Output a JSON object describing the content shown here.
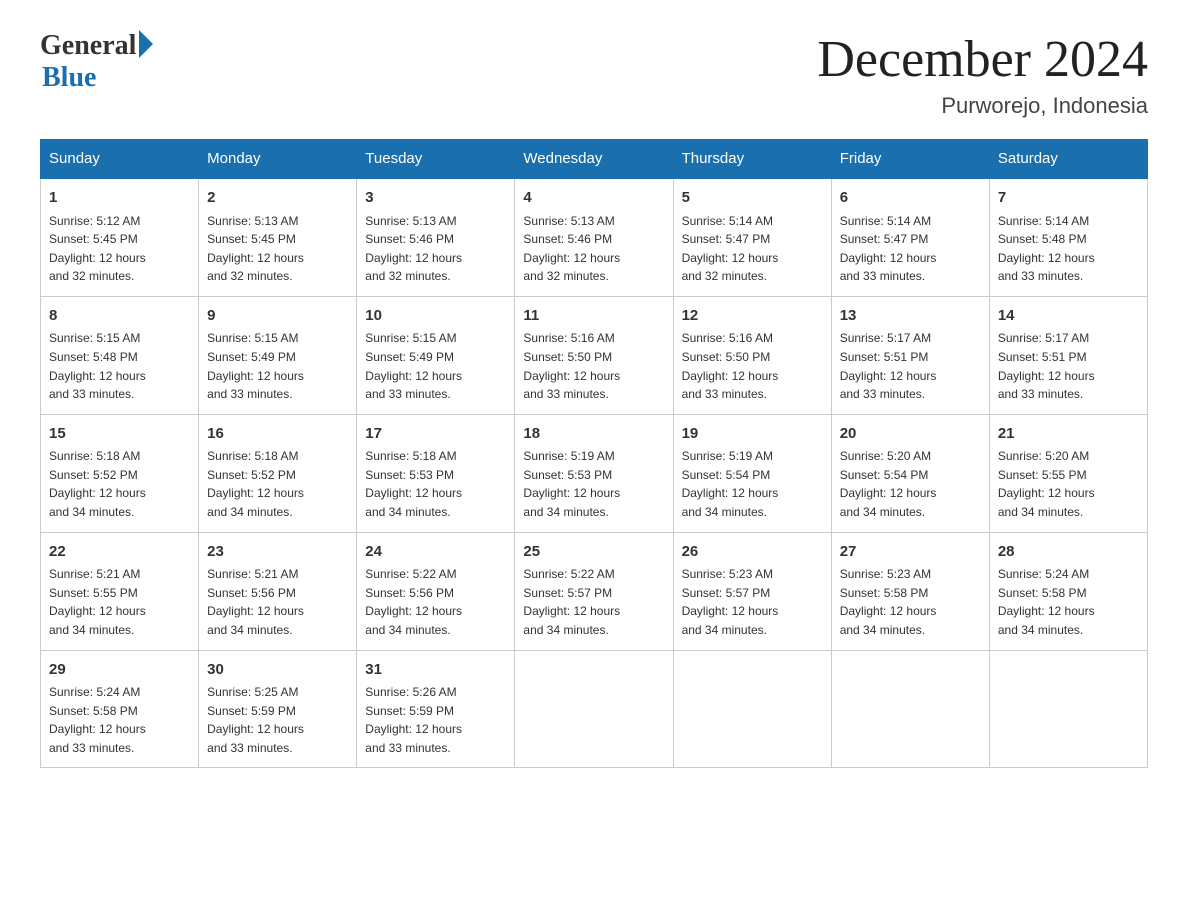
{
  "header": {
    "logo_general": "General",
    "logo_blue": "Blue",
    "month_title": "December 2024",
    "location": "Purworejo, Indonesia"
  },
  "days_of_week": [
    "Sunday",
    "Monday",
    "Tuesday",
    "Wednesday",
    "Thursday",
    "Friday",
    "Saturday"
  ],
  "weeks": [
    [
      {
        "day": "1",
        "sunrise": "5:12 AM",
        "sunset": "5:45 PM",
        "daylight": "12 hours and 32 minutes."
      },
      {
        "day": "2",
        "sunrise": "5:13 AM",
        "sunset": "5:45 PM",
        "daylight": "12 hours and 32 minutes."
      },
      {
        "day": "3",
        "sunrise": "5:13 AM",
        "sunset": "5:46 PM",
        "daylight": "12 hours and 32 minutes."
      },
      {
        "day": "4",
        "sunrise": "5:13 AM",
        "sunset": "5:46 PM",
        "daylight": "12 hours and 32 minutes."
      },
      {
        "day": "5",
        "sunrise": "5:14 AM",
        "sunset": "5:47 PM",
        "daylight": "12 hours and 32 minutes."
      },
      {
        "day": "6",
        "sunrise": "5:14 AM",
        "sunset": "5:47 PM",
        "daylight": "12 hours and 33 minutes."
      },
      {
        "day": "7",
        "sunrise": "5:14 AM",
        "sunset": "5:48 PM",
        "daylight": "12 hours and 33 minutes."
      }
    ],
    [
      {
        "day": "8",
        "sunrise": "5:15 AM",
        "sunset": "5:48 PM",
        "daylight": "12 hours and 33 minutes."
      },
      {
        "day": "9",
        "sunrise": "5:15 AM",
        "sunset": "5:49 PM",
        "daylight": "12 hours and 33 minutes."
      },
      {
        "day": "10",
        "sunrise": "5:15 AM",
        "sunset": "5:49 PM",
        "daylight": "12 hours and 33 minutes."
      },
      {
        "day": "11",
        "sunrise": "5:16 AM",
        "sunset": "5:50 PM",
        "daylight": "12 hours and 33 minutes."
      },
      {
        "day": "12",
        "sunrise": "5:16 AM",
        "sunset": "5:50 PM",
        "daylight": "12 hours and 33 minutes."
      },
      {
        "day": "13",
        "sunrise": "5:17 AM",
        "sunset": "5:51 PM",
        "daylight": "12 hours and 33 minutes."
      },
      {
        "day": "14",
        "sunrise": "5:17 AM",
        "sunset": "5:51 PM",
        "daylight": "12 hours and 33 minutes."
      }
    ],
    [
      {
        "day": "15",
        "sunrise": "5:18 AM",
        "sunset": "5:52 PM",
        "daylight": "12 hours and 34 minutes."
      },
      {
        "day": "16",
        "sunrise": "5:18 AM",
        "sunset": "5:52 PM",
        "daylight": "12 hours and 34 minutes."
      },
      {
        "day": "17",
        "sunrise": "5:18 AM",
        "sunset": "5:53 PM",
        "daylight": "12 hours and 34 minutes."
      },
      {
        "day": "18",
        "sunrise": "5:19 AM",
        "sunset": "5:53 PM",
        "daylight": "12 hours and 34 minutes."
      },
      {
        "day": "19",
        "sunrise": "5:19 AM",
        "sunset": "5:54 PM",
        "daylight": "12 hours and 34 minutes."
      },
      {
        "day": "20",
        "sunrise": "5:20 AM",
        "sunset": "5:54 PM",
        "daylight": "12 hours and 34 minutes."
      },
      {
        "day": "21",
        "sunrise": "5:20 AM",
        "sunset": "5:55 PM",
        "daylight": "12 hours and 34 minutes."
      }
    ],
    [
      {
        "day": "22",
        "sunrise": "5:21 AM",
        "sunset": "5:55 PM",
        "daylight": "12 hours and 34 minutes."
      },
      {
        "day": "23",
        "sunrise": "5:21 AM",
        "sunset": "5:56 PM",
        "daylight": "12 hours and 34 minutes."
      },
      {
        "day": "24",
        "sunrise": "5:22 AM",
        "sunset": "5:56 PM",
        "daylight": "12 hours and 34 minutes."
      },
      {
        "day": "25",
        "sunrise": "5:22 AM",
        "sunset": "5:57 PM",
        "daylight": "12 hours and 34 minutes."
      },
      {
        "day": "26",
        "sunrise": "5:23 AM",
        "sunset": "5:57 PM",
        "daylight": "12 hours and 34 minutes."
      },
      {
        "day": "27",
        "sunrise": "5:23 AM",
        "sunset": "5:58 PM",
        "daylight": "12 hours and 34 minutes."
      },
      {
        "day": "28",
        "sunrise": "5:24 AM",
        "sunset": "5:58 PM",
        "daylight": "12 hours and 34 minutes."
      }
    ],
    [
      {
        "day": "29",
        "sunrise": "5:24 AM",
        "sunset": "5:58 PM",
        "daylight": "12 hours and 33 minutes."
      },
      {
        "day": "30",
        "sunrise": "5:25 AM",
        "sunset": "5:59 PM",
        "daylight": "12 hours and 33 minutes."
      },
      {
        "day": "31",
        "sunrise": "5:26 AM",
        "sunset": "5:59 PM",
        "daylight": "12 hours and 33 minutes."
      },
      null,
      null,
      null,
      null
    ]
  ]
}
